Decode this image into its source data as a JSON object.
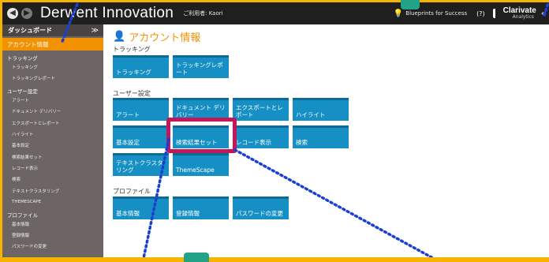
{
  "header": {
    "back_glyph": "◀",
    "forward_glyph": "▶",
    "brand": "Derwent Innovation",
    "user_label": "ご利用者: Kaori",
    "blueprints_label": "Blueprints for Success",
    "help_glyph": "(?)",
    "clarivate_name": "Clarivate",
    "clarivate_sub": "Analytics",
    "collapse_glyph": "«"
  },
  "sidebar": {
    "dashboard_label": "ダッシュボード",
    "chevron_glyph": "≫",
    "account_label": "アカウント情報",
    "sections": [
      {
        "label": "トラッキング",
        "items": [
          "トラッキング",
          "トラッキングレポート"
        ]
      },
      {
        "label": "ユーザー設定",
        "items": [
          "アラート",
          "ドキュメント デリバリー",
          "エクスポートとレポート",
          "ハイライト",
          "基本設定",
          "検索結果セット",
          "レコード表示",
          "検索",
          "テキストクラスタリング",
          "THEMESCAPE"
        ]
      },
      {
        "label": "プロファイル",
        "items": [
          "基本情報",
          "登録情報",
          "パスワードの変更"
        ]
      }
    ]
  },
  "main": {
    "page_title": "アカウント情報",
    "tracking_label": "トラッキング",
    "user_settings_label": "ユーザー設定",
    "profile_label": "プロファイル",
    "tiles": {
      "tracking": "トラッキング",
      "tracking_report": "トラッキングレポート",
      "alert": "アラート",
      "document_delivery": "ドキュメント デリバリー",
      "export_report": "エクスポートとレポート",
      "highlight": "ハイライト",
      "basic_settings": "基本設定",
      "result_set": "検索結果セット",
      "record_display": "レコード表示",
      "search": "検索",
      "text_clustering": "テキストクラスタリング",
      "themescape": "ThemeScape",
      "basic_info": "基本情報",
      "registration_info": "登録情報",
      "password_change": "パスワードの変更"
    }
  },
  "colors": {
    "accent_orange": "#f39200",
    "tile_blue": "#168fc4",
    "highlight_magenta": "#c2185b",
    "frame_yellow": "#f5b400",
    "dots_blue": "#1a3fd1"
  }
}
